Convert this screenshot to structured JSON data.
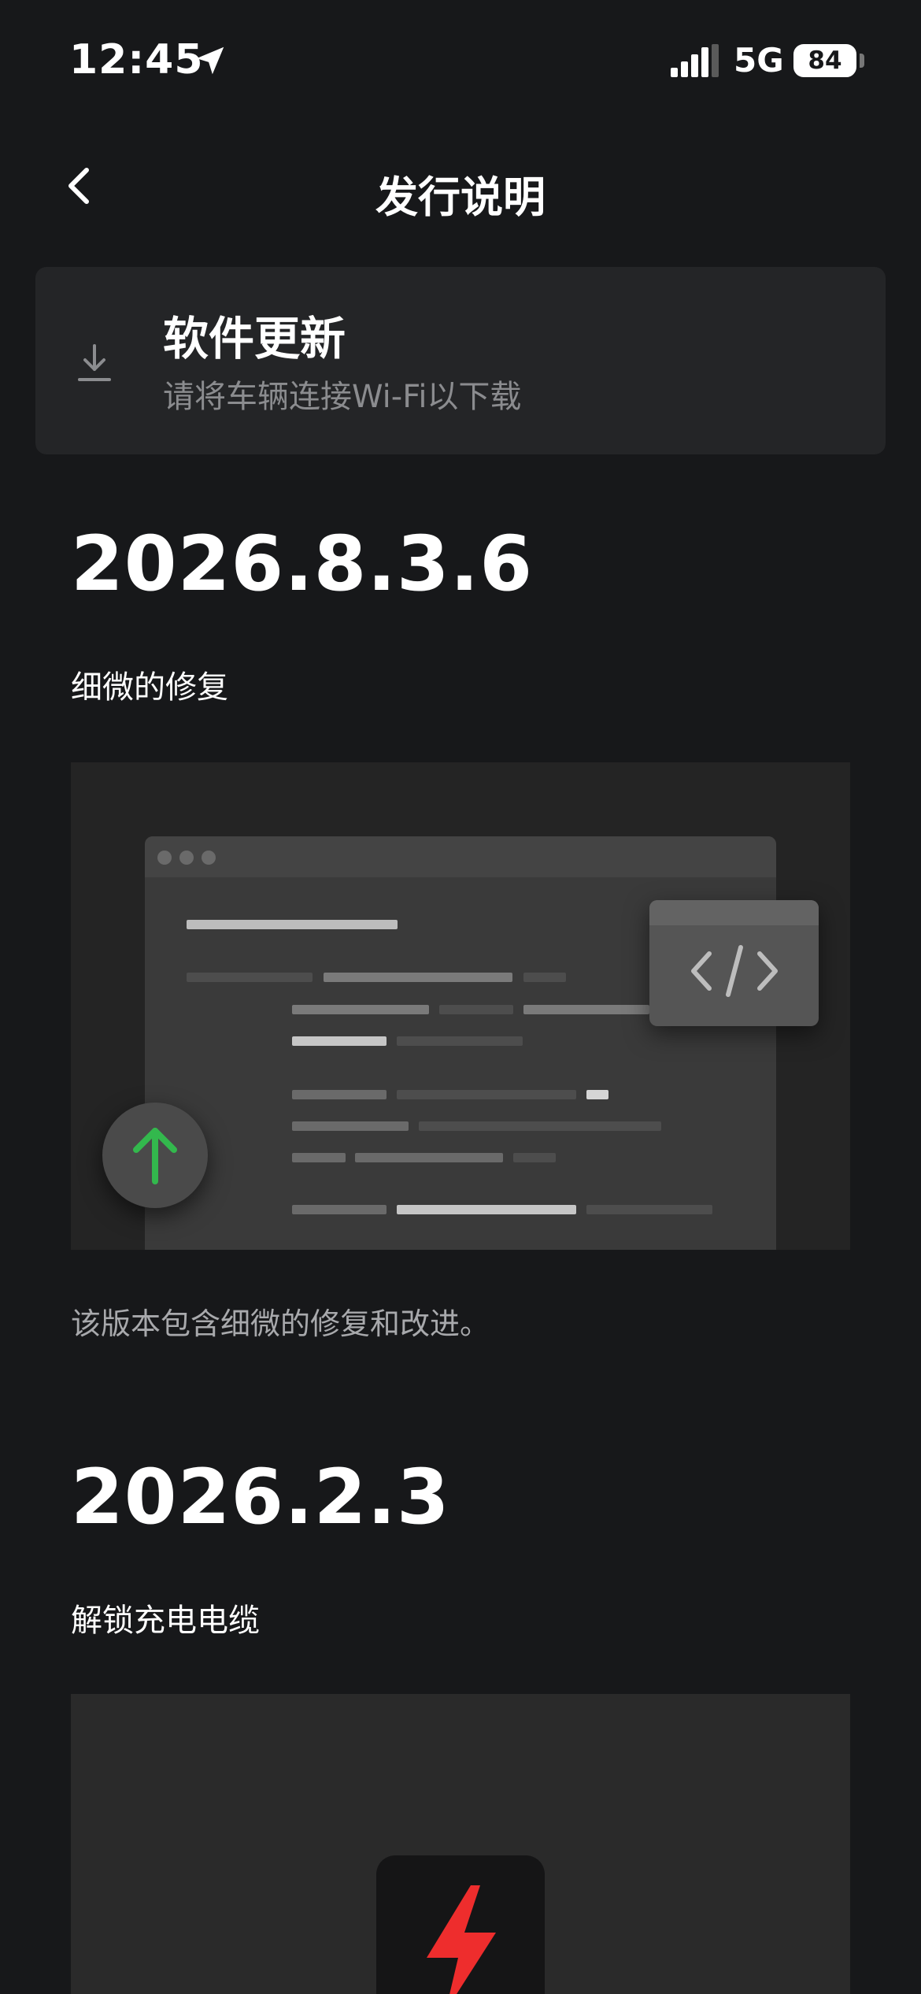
{
  "status_bar": {
    "time": "12:45",
    "network": "5G",
    "battery": "84",
    "icons": [
      "location-arrow-icon",
      "signal-icon"
    ]
  },
  "nav": {
    "title": "发行说明",
    "back_icon": "chevron-left-icon"
  },
  "update_card": {
    "icon": "download-icon",
    "title": "软件更新",
    "subtitle": "请将车辆连接Wi-Fi以下载"
  },
  "releases": [
    {
      "version": "2026.8.3.6",
      "title": "细微的修复",
      "illustration": "code-window-illustration",
      "illustration_icons": [
        "code-icon",
        "arrow-up-icon"
      ],
      "description": "该版本包含细微的修复和改进。"
    },
    {
      "version": "2026.2.3",
      "title": "解锁充电电缆",
      "illustration": "charging-illustration",
      "illustration_icons": [
        "lightning-bolt-icon"
      ]
    }
  ],
  "colors": {
    "background": "#17181a",
    "card": "#242527",
    "accent_green": "#33b84d",
    "accent_red": "#ee2d2d",
    "muted_text": "#8b8c8f"
  }
}
